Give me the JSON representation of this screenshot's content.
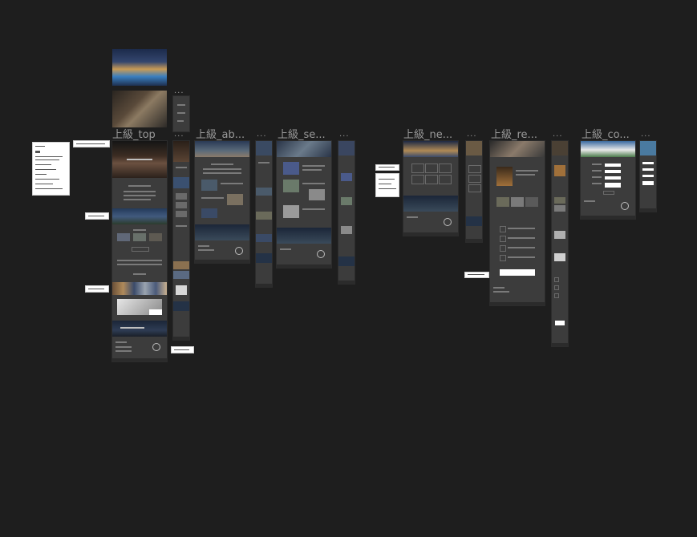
{
  "artboards": {
    "top": "上級_top",
    "about": "上級_ab...",
    "service": "上級_se...",
    "news": "上級_ne...",
    "recruit": "上級_re...",
    "contact": "上級_co..."
  },
  "more_marker": "...",
  "colors": {
    "canvas": "#1e1e1e",
    "artboard": "#3c3c3c",
    "label": "#9a9a9a",
    "note": "#ffffff"
  }
}
